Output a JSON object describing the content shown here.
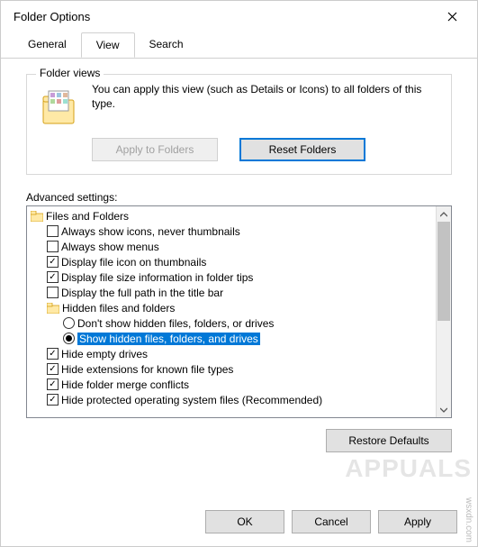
{
  "window": {
    "title": "Folder Options"
  },
  "tabs": {
    "general": "General",
    "view": "View",
    "search": "Search"
  },
  "folder_views": {
    "legend": "Folder views",
    "text": "You can apply this view (such as Details or Icons) to all folders of this type.",
    "apply_btn": "Apply to Folders",
    "reset_btn": "Reset Folders"
  },
  "advanced": {
    "label": "Advanced settings:",
    "root": "Files and Folders",
    "items": [
      {
        "label": "Always show icons, never thumbnails",
        "checked": false
      },
      {
        "label": "Always show menus",
        "checked": false
      },
      {
        "label": "Display file icon on thumbnails",
        "checked": true
      },
      {
        "label": "Display file size information in folder tips",
        "checked": true
      },
      {
        "label": "Display the full path in the title bar",
        "checked": false
      }
    ],
    "hidden_group": {
      "label": "Hidden files and folders",
      "options": [
        {
          "label": "Don't show hidden files, folders, or drives",
          "selected": false
        },
        {
          "label": "Show hidden files, folders, and drives",
          "selected": true
        }
      ]
    },
    "items2": [
      {
        "label": "Hide empty drives",
        "checked": true
      },
      {
        "label": "Hide extensions for known file types",
        "checked": true
      },
      {
        "label": "Hide folder merge conflicts",
        "checked": true
      },
      {
        "label": "Hide protected operating system files (Recommended)",
        "checked": true
      }
    ],
    "restore_btn": "Restore Defaults"
  },
  "buttons": {
    "ok": "OK",
    "cancel": "Cancel",
    "apply": "Apply"
  },
  "watermark": {
    "brand": "APPUALS",
    "src": "wsxdn.com"
  }
}
